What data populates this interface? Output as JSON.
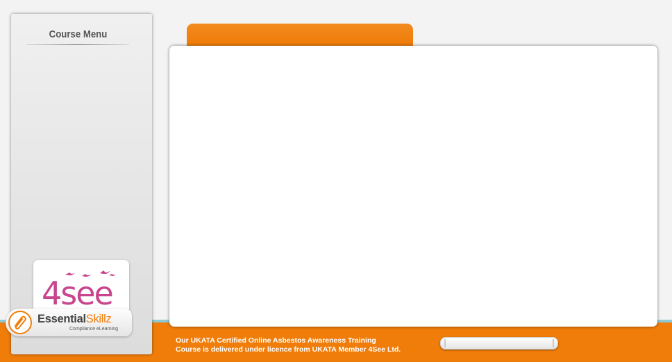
{
  "sidebar": {
    "title": "Course Menu",
    "partner_logo": {
      "text": "4see",
      "icon": "flying-birds-icon"
    }
  },
  "brand": {
    "name_part1": "Essential",
    "name_part2": "Skillz",
    "tagline": "Compliance eLearning",
    "icon": "paperclip-icon"
  },
  "footer": {
    "line1": "Our UKATA Certified Online Asbestos Awareness Training",
    "line2": "Course is delivered under licence from UKATA Member 4See Ltd."
  },
  "progress": {
    "fraction": 0.0
  },
  "colors": {
    "accent_orange": "#f07d0a",
    "teal_line": "#8fc9d6",
    "sidebar_bg": "#e4e4e4",
    "partner_magenta": "#c8468e"
  }
}
